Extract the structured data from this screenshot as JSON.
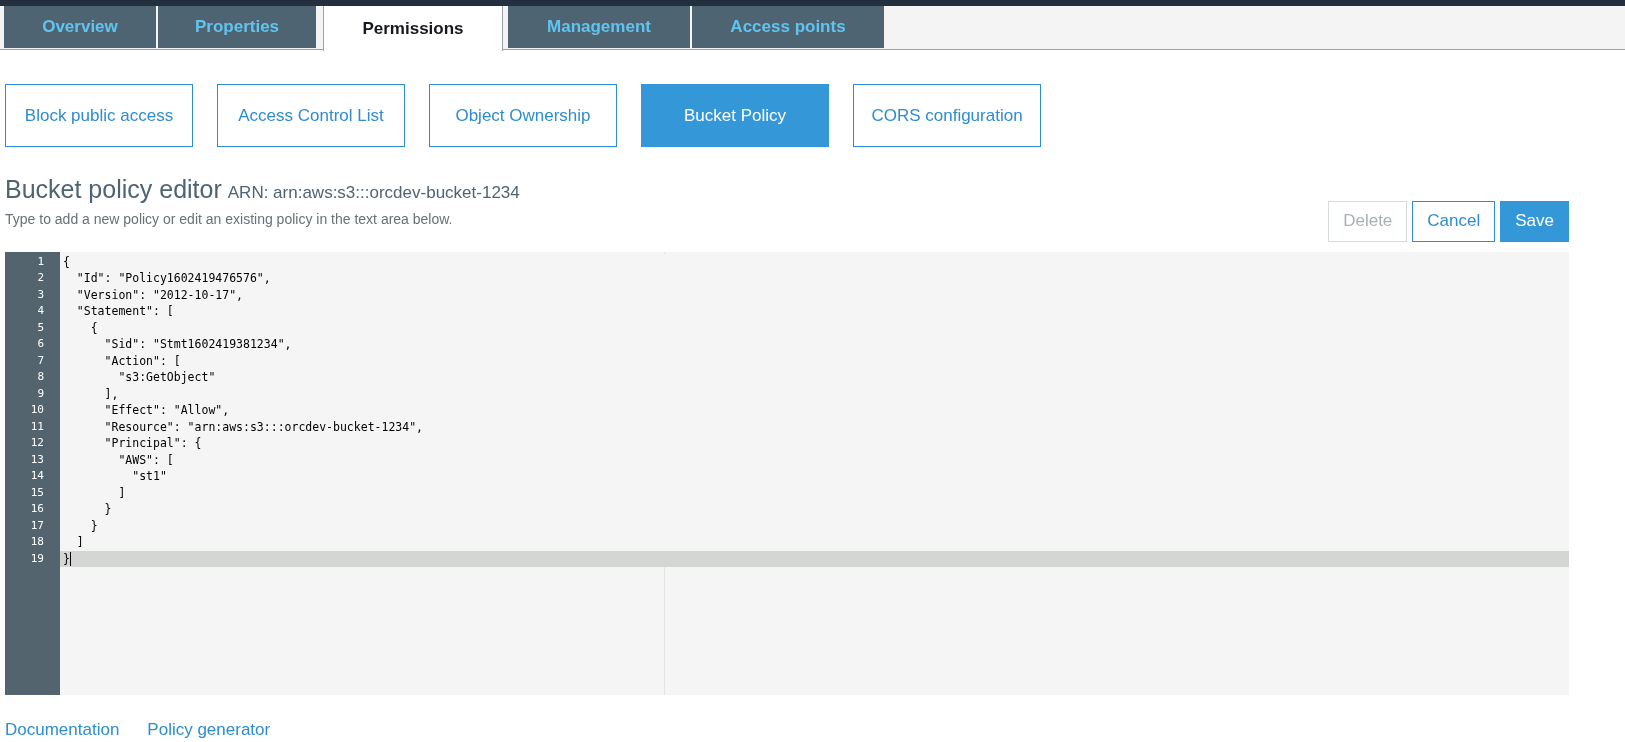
{
  "tabs": [
    {
      "label": "Overview",
      "selected": false
    },
    {
      "label": "Properties",
      "selected": false
    },
    {
      "label": "Permissions",
      "selected": true
    },
    {
      "label": "Management",
      "selected": false
    },
    {
      "label": "Access points",
      "selected": false
    }
  ],
  "subtabs": [
    {
      "label": "Block public access",
      "selected": false
    },
    {
      "label": "Access Control List",
      "selected": false
    },
    {
      "label": "Object Ownership",
      "selected": false
    },
    {
      "label": "Bucket Policy",
      "selected": true
    },
    {
      "label": "CORS configuration",
      "selected": false
    }
  ],
  "editor_header": {
    "title": "Bucket policy editor",
    "arn": "ARN: arn:aws:s3:::orcdev-bucket-1234",
    "description": "Type to add a new policy or edit an existing policy in the text area below."
  },
  "actions": [
    {
      "label": "Delete",
      "kind": "outline",
      "disabled": true
    },
    {
      "label": "Cancel",
      "kind": "outline",
      "disabled": false
    },
    {
      "label": "Save",
      "kind": "primary",
      "disabled": false
    }
  ],
  "editor": {
    "lines": [
      {
        "number": "1",
        "text": "{",
        "active": false
      },
      {
        "number": "2",
        "text": "  \"Id\": \"Policy1602419476576\",",
        "active": false
      },
      {
        "number": "3",
        "text": "  \"Version\": \"2012-10-17\",",
        "active": false
      },
      {
        "number": "4",
        "text": "  \"Statement\": [",
        "active": false
      },
      {
        "number": "5",
        "text": "    {",
        "active": false
      },
      {
        "number": "6",
        "text": "      \"Sid\": \"Stmt1602419381234\",",
        "active": false
      },
      {
        "number": "7",
        "text": "      \"Action\": [",
        "active": false
      },
      {
        "number": "8",
        "text": "        \"s3:GetObject\"",
        "active": false
      },
      {
        "number": "9",
        "text": "      ],",
        "active": false
      },
      {
        "number": "10",
        "text": "      \"Effect\": \"Allow\",",
        "active": false
      },
      {
        "number": "11",
        "text": "      \"Resource\": \"arn:aws:s3:::orcdev-bucket-1234\",",
        "active": false
      },
      {
        "number": "12",
        "text": "      \"Principal\": {",
        "active": false
      },
      {
        "number": "13",
        "text": "        \"AWS\": [",
        "active": false
      },
      {
        "number": "14",
        "text": "          \"st1\"",
        "active": false
      },
      {
        "number": "15",
        "text": "        ]",
        "active": false
      },
      {
        "number": "16",
        "text": "      }",
        "active": false
      },
      {
        "number": "17",
        "text": "    }",
        "active": false
      },
      {
        "number": "18",
        "text": "  ]",
        "active": false
      },
      {
        "number": "19",
        "text": "}",
        "active": true
      }
    ]
  },
  "footer_links": [
    "Documentation",
    "Policy generator"
  ]
}
